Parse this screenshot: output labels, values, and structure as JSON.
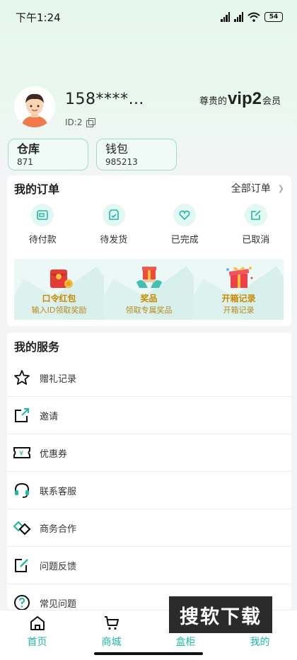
{
  "status_bar": {
    "time": "下午1:24",
    "signal1_label": "HD",
    "signal2_label": "HD",
    "battery": "54"
  },
  "profile": {
    "phone": "158****…",
    "uid": "ID:2",
    "vip_prefix": "尊贵的",
    "vip_level": "vip2",
    "vip_suffix": "会员"
  },
  "cards": [
    {
      "title": "仓库",
      "value": "871"
    },
    {
      "title": "钱包",
      "value": "985213"
    }
  ],
  "orders": {
    "title": "我的订单",
    "all_label": "全部订单",
    "items": [
      {
        "label": "待付款",
        "icon": "wallet-icon"
      },
      {
        "label": "待发货",
        "icon": "package-icon"
      },
      {
        "label": "已完成",
        "icon": "heart-icon"
      },
      {
        "label": "已取消",
        "icon": "edit-icon"
      }
    ],
    "promos": [
      {
        "title": "口令红包",
        "subtitle": "输入ID领取奖励",
        "icon": "red-envelope-icon"
      },
      {
        "title": "奖品",
        "subtitle": "领取专属奖品",
        "icon": "gift-hands-icon"
      },
      {
        "title": "开箱记录",
        "subtitle": "开箱记录",
        "icon": "gift-box-icon"
      }
    ]
  },
  "services": {
    "title": "我的服务",
    "items": [
      {
        "label": "赠礼记录",
        "icon": "star-icon"
      },
      {
        "label": "邀请",
        "icon": "share-icon"
      },
      {
        "label": "优惠券",
        "icon": "coupon-icon"
      },
      {
        "label": "联系客服",
        "icon": "headset-icon"
      },
      {
        "label": "商务合作",
        "icon": "handshake-icon"
      },
      {
        "label": "问题反馈",
        "icon": "feedback-icon"
      },
      {
        "label": "常见问题",
        "icon": "question-icon"
      }
    ]
  },
  "tabbar": [
    {
      "label": "首页",
      "icon": "home-icon"
    },
    {
      "label": "商城",
      "icon": "cart-icon"
    },
    {
      "label": "盒柜",
      "icon": "box-icon"
    },
    {
      "label": "我的",
      "icon": "profile-icon"
    }
  ],
  "watermark": "搜软下载",
  "colors": {
    "accent": "#20b8a8",
    "card_border": "#9fdcd0",
    "promo_text": "#c98a00"
  }
}
